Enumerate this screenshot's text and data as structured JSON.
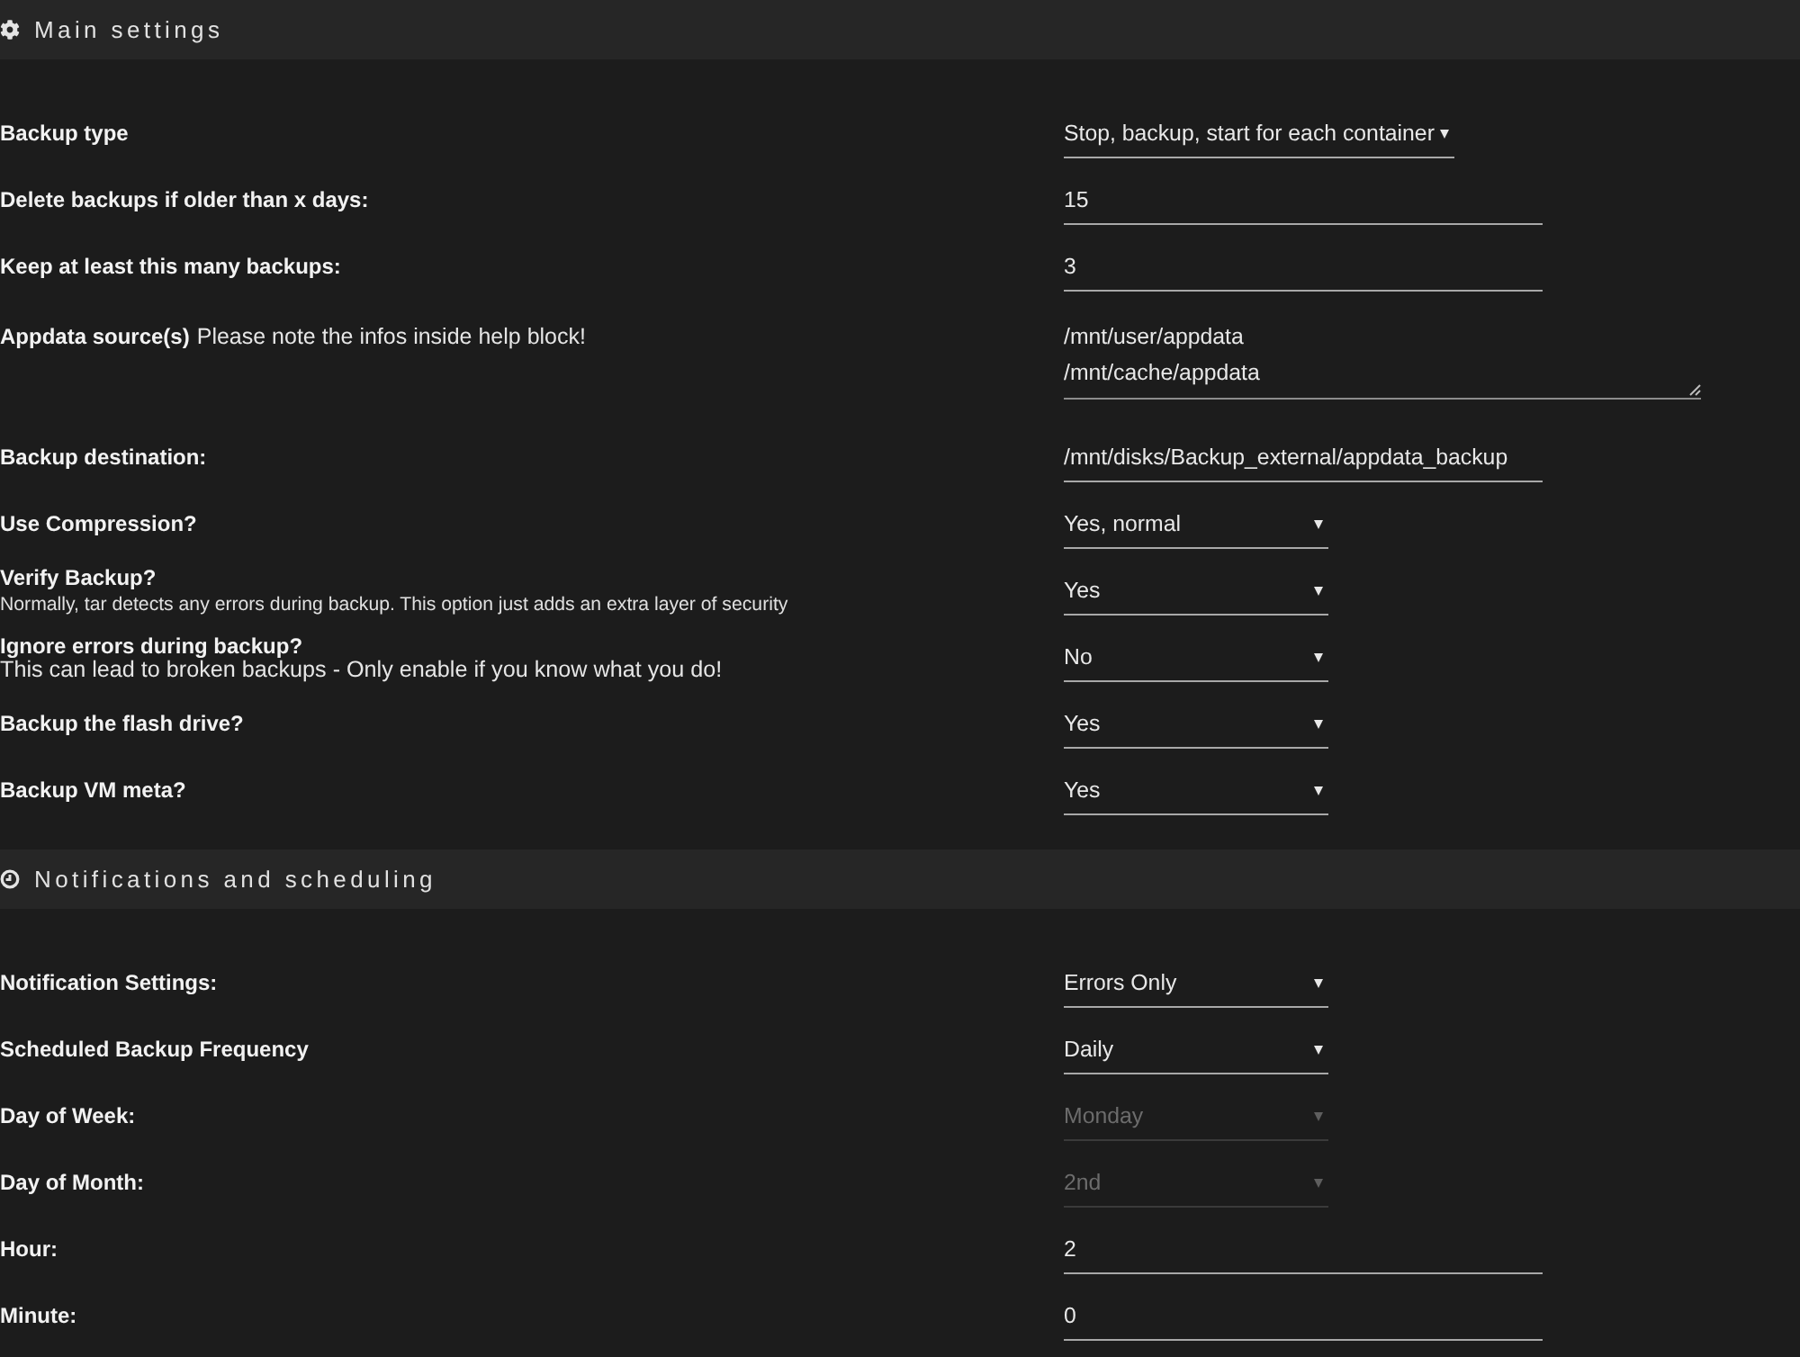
{
  "sections": [
    {
      "title": "Main settings",
      "rows": [
        {
          "label": "Backup type",
          "control": {
            "kind": "select",
            "value": "Stop, backup, start for each container",
            "disabled": false
          }
        },
        {
          "label": "Delete backups if older than x days:",
          "control": {
            "kind": "text",
            "value": "15",
            "disabled": false
          }
        },
        {
          "label": "Keep at least this many backups:",
          "control": {
            "kind": "text",
            "value": "3",
            "disabled": false
          }
        },
        {
          "label": "Appdata source(s)",
          "help": {
            "kind": "inline",
            "text": "Please note the infos inside help block!"
          },
          "control": {
            "kind": "textarea",
            "value": "/mnt/user/appdata\n/mnt/cache/appdata",
            "disabled": false
          }
        },
        {
          "label": "Backup destination:",
          "control": {
            "kind": "text",
            "value": "/mnt/disks/Backup_external/appdata_backup",
            "disabled": false
          }
        },
        {
          "label": "Use Compression?",
          "control": {
            "kind": "select",
            "value": "Yes, normal",
            "disabled": false
          }
        },
        {
          "label": "Verify Backup?",
          "help": {
            "kind": "fine_print",
            "text": "Normally, tar detects any errors during backup. This option just adds an extra layer of security"
          },
          "control": {
            "kind": "select",
            "value": "Yes",
            "disabled": false
          }
        },
        {
          "label": "Ignore errors during backup?",
          "help": {
            "kind": "caption",
            "text": "This can lead to broken backups - Only enable if you know what you do!"
          },
          "control": {
            "kind": "select",
            "value": "No",
            "disabled": false
          }
        },
        {
          "label": "Backup the flash drive?",
          "control": {
            "kind": "select",
            "value": "Yes",
            "disabled": false
          }
        },
        {
          "label": "Backup VM meta?",
          "control": {
            "kind": "select",
            "value": "Yes",
            "disabled": false
          }
        }
      ]
    },
    {
      "title": "Notifications and scheduling",
      "rows": [
        {
          "label": "Notification Settings:",
          "control": {
            "kind": "select",
            "value": "Errors Only",
            "disabled": false
          }
        },
        {
          "label": "Scheduled Backup Frequency",
          "control": {
            "kind": "select",
            "value": "Daily",
            "disabled": false
          }
        },
        {
          "label": "Day of Week:",
          "control": {
            "kind": "select",
            "value": "Monday",
            "disabled": true
          }
        },
        {
          "label": "Day of Month:",
          "control": {
            "kind": "select",
            "value": "2nd",
            "disabled": true
          }
        },
        {
          "label": "Hour:",
          "control": {
            "kind": "text",
            "value": "2",
            "disabled": false
          }
        },
        {
          "label": "Minute:",
          "control": {
            "kind": "text",
            "value": "0",
            "disabled": false
          }
        }
      ]
    }
  ]
}
